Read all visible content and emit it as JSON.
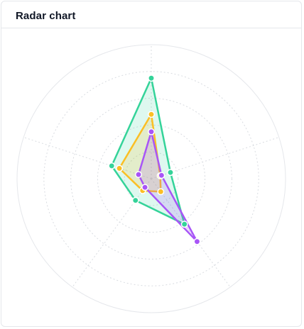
{
  "card": {
    "title": "Radar chart"
  },
  "chart_data": {
    "type": "radar",
    "axes_count": 5,
    "range": [
      0,
      100
    ],
    "rings": 5,
    "grid": true,
    "legend": "none",
    "series": [
      {
        "values": [
          75,
          15,
          42,
          20,
          31
        ],
        "color": "#34d399",
        "fill_opacity": 0.16
      },
      {
        "values": [
          48,
          7,
          12,
          11,
          25
        ],
        "color": "#fbbf24",
        "fill_opacity": 0.18
      },
      {
        "values": [
          35,
          8,
          58,
          8,
          10
        ],
        "color": "#a855f7",
        "fill_opacity": 0.18
      }
    ]
  }
}
